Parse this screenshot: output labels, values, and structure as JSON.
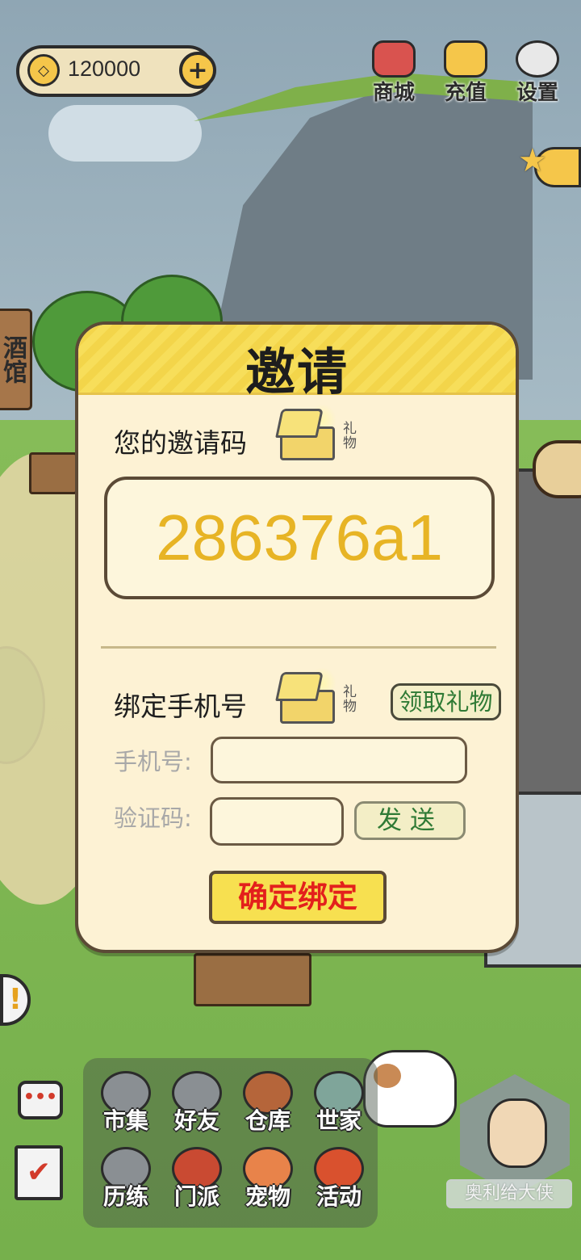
{
  "top_bar": {
    "currency_amount": "120000",
    "add_currency_symbol": "+",
    "shop_label": "商城",
    "recharge_label": "充值",
    "settings_label": "设置"
  },
  "side": {
    "tavern_label": "酒馆"
  },
  "invite_modal": {
    "title": "邀请",
    "invite_code_label": "您的邀请码",
    "gift_tag": "礼物",
    "invite_code": "286376a1",
    "bind_phone_label": "绑定手机号",
    "claim_gift_button": "领取礼物",
    "phone_label": "手机号:",
    "phone_value": "",
    "verify_label": "验证码:",
    "verify_value": "",
    "send_button": "发送",
    "confirm_button": "确定绑定"
  },
  "bottom_menu": {
    "items": [
      {
        "label": "市集",
        "icon": "market-icon"
      },
      {
        "label": "好友",
        "icon": "handshake-icon"
      },
      {
        "label": "仓库",
        "icon": "chest-icon"
      },
      {
        "label": "世家",
        "icon": "armor-icon"
      },
      {
        "label": "历练",
        "icon": "swords-icon"
      },
      {
        "label": "门派",
        "icon": "banner-icon"
      },
      {
        "label": "宠物",
        "icon": "paw-icon"
      },
      {
        "label": "活动",
        "icon": "lantern-icon"
      }
    ]
  },
  "player": {
    "name": "奥利给大侠"
  },
  "colors": {
    "accent_yellow": "#f7e050",
    "code_gold": "#e7b425",
    "confirm_red": "#e3201c",
    "claim_green": "#2f7a35"
  }
}
